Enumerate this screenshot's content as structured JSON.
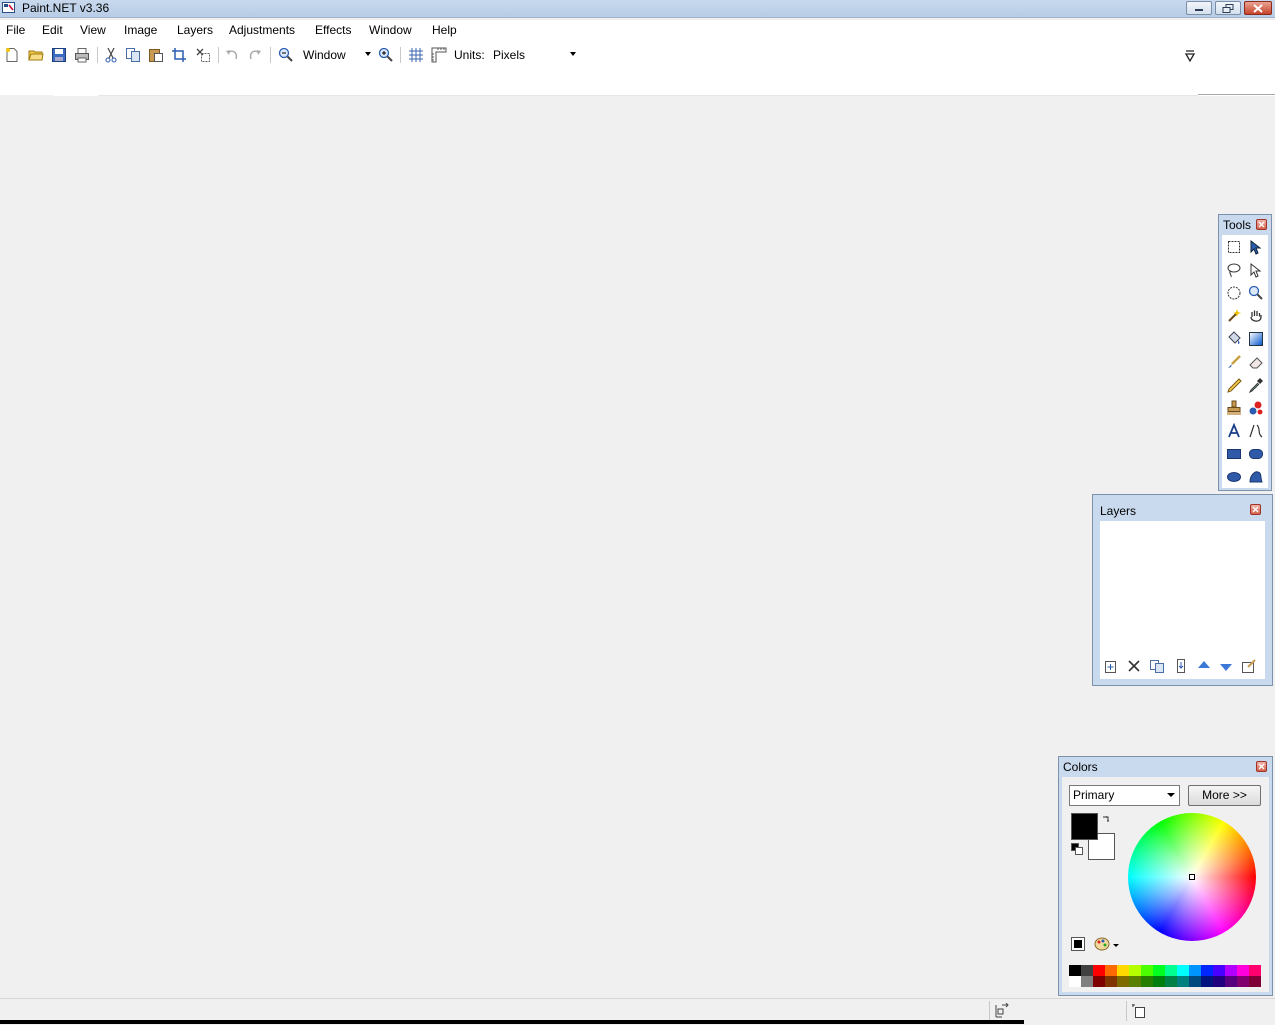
{
  "window": {
    "title": "Paint.NET v3.36"
  },
  "menu": {
    "file": "File",
    "edit": "Edit",
    "view": "View",
    "image": "Image",
    "layers": "Layers",
    "adjustments": "Adjustments",
    "effects": "Effects",
    "window": "Window",
    "help": "Help"
  },
  "toolbar": {
    "zoom_value": "Window",
    "units_label": "Units:",
    "units_value": "Pixels",
    "icons": [
      "new-icon",
      "open-icon",
      "save-icon",
      "print-icon",
      "cut-icon",
      "copy-icon",
      "paste-icon",
      "crop-icon",
      "deselect-icon",
      "undo-icon",
      "redo-icon",
      "zoom-out-icon",
      "zoom-in-icon",
      "grid-icon",
      "rulers-icon"
    ]
  },
  "tools_panel": {
    "title": "Tools",
    "tools": [
      "rectangle-select",
      "move-selected-pixels",
      "lasso-select",
      "move-selection",
      "ellipse-select",
      "zoom",
      "magic-wand",
      "pan",
      "paint-bucket",
      "gradient",
      "paintbrush",
      "eraser",
      "pencil",
      "color-picker",
      "clone-stamp",
      "recolor",
      "text",
      "line-curve",
      "rectangle",
      "rounded-rectangle",
      "ellipse",
      "freeform-shape"
    ]
  },
  "layers_panel": {
    "title": "Layers",
    "buttons": [
      "add-layer",
      "delete-layer",
      "duplicate-layer",
      "merge-layer-down",
      "move-layer-up",
      "move-layer-down",
      "layer-properties"
    ]
  },
  "colors_panel": {
    "title": "Colors",
    "mode_value": "Primary",
    "more_label": "More >>",
    "primary_color": "#000000",
    "secondary_color": "#ffffff",
    "palette_top": [
      "#000000",
      "#404040",
      "#ff0000",
      "#ff6a00",
      "#ffd800",
      "#b6ff00",
      "#4cff00",
      "#00ff21",
      "#00ff90",
      "#00ffff",
      "#0094ff",
      "#0026ff",
      "#4800ff",
      "#b200ff",
      "#ff00dc",
      "#ff006e"
    ],
    "palette_bottom": [
      "#ffffff",
      "#808080",
      "#7f0000",
      "#7f3300",
      "#7f6a00",
      "#5b7f00",
      "#267f00",
      "#007f0e",
      "#007f46",
      "#007f7f",
      "#004a7f",
      "#00137f",
      "#21007f",
      "#57007f",
      "#7f006e",
      "#7f0037"
    ]
  }
}
